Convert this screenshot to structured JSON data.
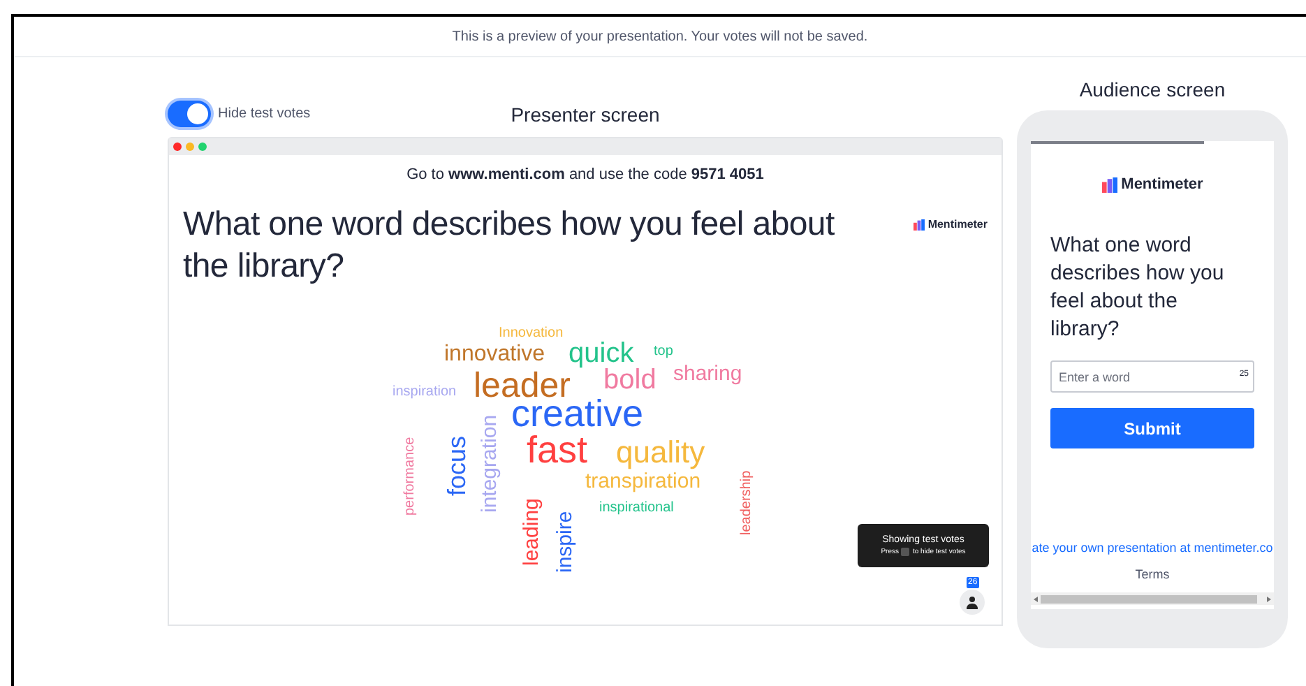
{
  "banner": "This is a preview of your presentation. Your votes will not be saved.",
  "presenter": {
    "toggle": {
      "label": "Hide test votes",
      "on": true
    },
    "title": "Presenter screen",
    "join_prefix": "Go to",
    "join_url": "www.menti.com",
    "join_middle": "and use the code",
    "join_code": "9571 4051",
    "brand": "Mentimeter",
    "question": "What one word describes how you feel about the library?",
    "words": [
      {
        "text": "Innovation",
        "color": "#f5b83d"
      },
      {
        "text": "innovative",
        "color": "#c0762a"
      },
      {
        "text": "quick",
        "color": "#23c38b"
      },
      {
        "text": "top",
        "color": "#23c38b"
      },
      {
        "text": "leader",
        "color": "#c46d22"
      },
      {
        "text": "bold",
        "color": "#f07aa0"
      },
      {
        "text": "sharing",
        "color": "#f07aa0"
      },
      {
        "text": "inspiration",
        "color": "#a7a7f0"
      },
      {
        "text": "creative",
        "color": "#2b67f5"
      },
      {
        "text": "fast",
        "color": "#ff4040"
      },
      {
        "text": "quality",
        "color": "#f5b83d"
      },
      {
        "text": "transpiration",
        "color": "#f5b83d"
      },
      {
        "text": "inspirational",
        "color": "#23c38b"
      },
      {
        "text": "focus",
        "color": "#2b67f5"
      },
      {
        "text": "integration",
        "color": "#a7a7f0"
      },
      {
        "text": "performance",
        "color": "#f07aa0"
      },
      {
        "text": "leading",
        "color": "#ff4040"
      },
      {
        "text": "inspire",
        "color": "#2b67f5"
      },
      {
        "text": "leadership",
        "color": "#f06060"
      }
    ],
    "toast": {
      "title": "Showing test votes",
      "press": "Press",
      "hint": "to hide test votes"
    },
    "votes": "26"
  },
  "audience": {
    "title": "Audience screen",
    "brand": "Mentimeter",
    "question": "What one word describes how you feel about the library?",
    "input": {
      "placeholder": "Enter a word",
      "counter": "25"
    },
    "submit": "Submit",
    "link": "ate your own presentation at mentimeter.co",
    "terms": "Terms"
  }
}
